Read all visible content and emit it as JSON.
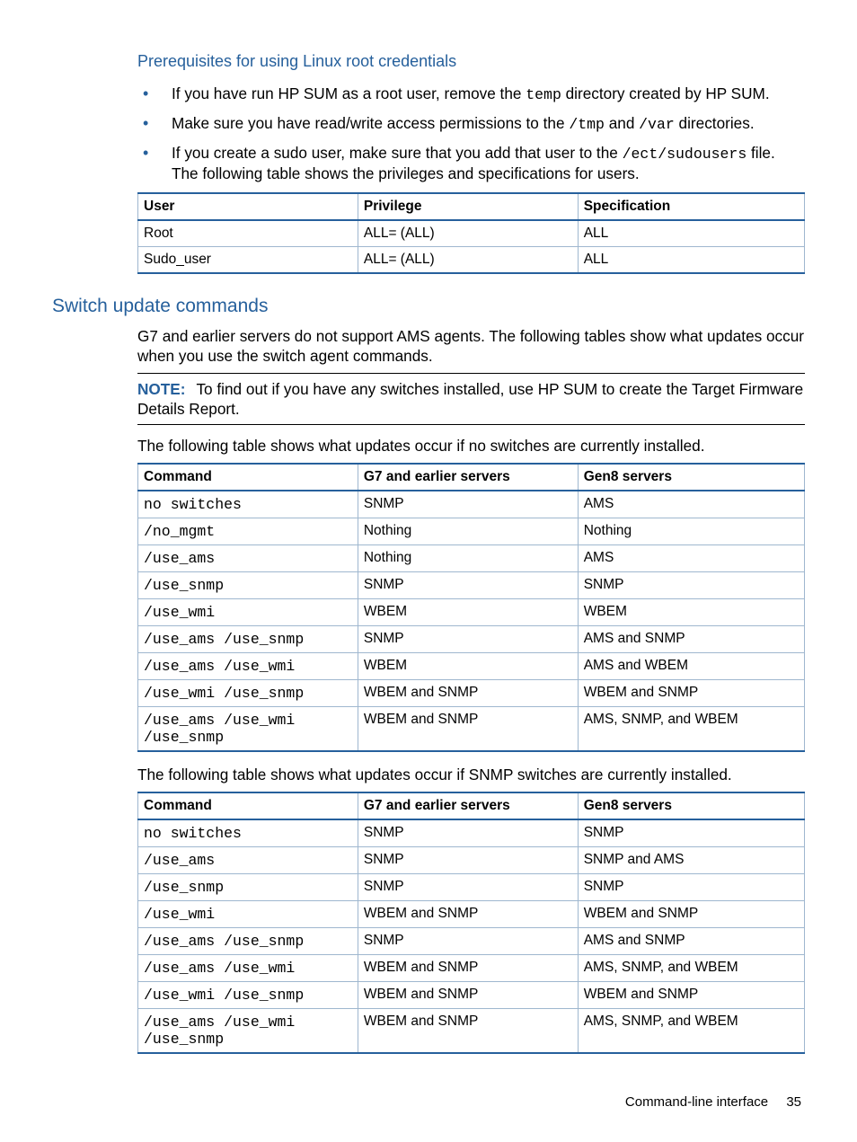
{
  "prereq": {
    "heading": "Prerequisites for using Linux root credentials",
    "bullets": {
      "b0_a": "If you have run HP SUM as a root user, remove the ",
      "b0_code": "temp",
      "b0_b": " directory created by HP SUM.",
      "b1_a": "Make sure you have read/write access permissions to the ",
      "b1_code1": "/tmp",
      "b1_mid": " and ",
      "b1_code2": "/var",
      "b1_b": " directories.",
      "b2_a": "If you create a sudo user, make sure that you add that user to the ",
      "b2_code": "/ect/sudousers",
      "b2_b": " file. The following table shows the privileges and specifications for users."
    }
  },
  "userTable": {
    "headers": {
      "c0": "User",
      "c1": "Privilege",
      "c2": "Specification"
    },
    "rows": [
      {
        "c0": "Root",
        "c1": "ALL= (ALL)",
        "c2": "ALL"
      },
      {
        "c0": "Sudo_user",
        "c1": "ALL= (ALL)",
        "c2": "ALL"
      }
    ]
  },
  "switch": {
    "heading": "Switch update commands",
    "intro": "G7 and earlier servers do not support AMS agents. The following tables show what updates occur when you use the switch agent commands.",
    "noteLabel": "NOTE:",
    "noteText": "To find out if you have any switches installed, use HP SUM to create the Target Firmware Details Report.",
    "p1": "The following table shows what updates occur if no switches are currently installed.",
    "p2": "The following table shows what updates occur if SNMP switches are currently installed."
  },
  "table1": {
    "headers": {
      "c0": "Command",
      "c1": "G7 and earlier servers",
      "c2": "Gen8 servers"
    },
    "rows": [
      {
        "c0": "no switches",
        "c1": "SNMP",
        "c2": "AMS"
      },
      {
        "c0": "/no_mgmt",
        "c1": "Nothing",
        "c2": "Nothing"
      },
      {
        "c0": "/use_ams",
        "c1": "Nothing",
        "c2": "AMS"
      },
      {
        "c0": "/use_snmp",
        "c1": "SNMP",
        "c2": "SNMP"
      },
      {
        "c0": "/use_wmi",
        "c1": "WBEM",
        "c2": "WBEM"
      },
      {
        "c0": "/use_ams /use_snmp",
        "c1": "SNMP",
        "c2": "AMS and SNMP"
      },
      {
        "c0": "/use_ams /use_wmi",
        "c1": "WBEM",
        "c2": "AMS and WBEM"
      },
      {
        "c0": "/use_wmi /use_snmp",
        "c1": "WBEM and SNMP",
        "c2": "WBEM and SNMP"
      },
      {
        "c0": "/use_ams /use_wmi /use_snmp",
        "c1": "WBEM and SNMP",
        "c2": "AMS, SNMP, and WBEM"
      }
    ]
  },
  "table2": {
    "headers": {
      "c0": "Command",
      "c1": "G7 and earlier servers",
      "c2": "Gen8 servers"
    },
    "rows": [
      {
        "c0": "no switches",
        "c1": "SNMP",
        "c2": "SNMP"
      },
      {
        "c0": "/use_ams",
        "c1": "SNMP",
        "c2": "SNMP and AMS"
      },
      {
        "c0": "/use_snmp",
        "c1": "SNMP",
        "c2": "SNMP"
      },
      {
        "c0": "/use_wmi",
        "c1": "WBEM and SNMP",
        "c2": "WBEM and SNMP"
      },
      {
        "c0": "/use_ams /use_snmp",
        "c1": "SNMP",
        "c2": "AMS and SNMP"
      },
      {
        "c0": "/use_ams /use_wmi",
        "c1": "WBEM and SNMP",
        "c2": "AMS, SNMP, and WBEM"
      },
      {
        "c0": "/use_wmi /use_snmp",
        "c1": "WBEM and SNMP",
        "c2": "WBEM and SNMP"
      },
      {
        "c0": "/use_ams /use_wmi /use_snmp",
        "c1": "WBEM and SNMP",
        "c2": "AMS, SNMP, and WBEM"
      }
    ]
  },
  "footer": {
    "title": "Command-line interface",
    "page": "35"
  }
}
